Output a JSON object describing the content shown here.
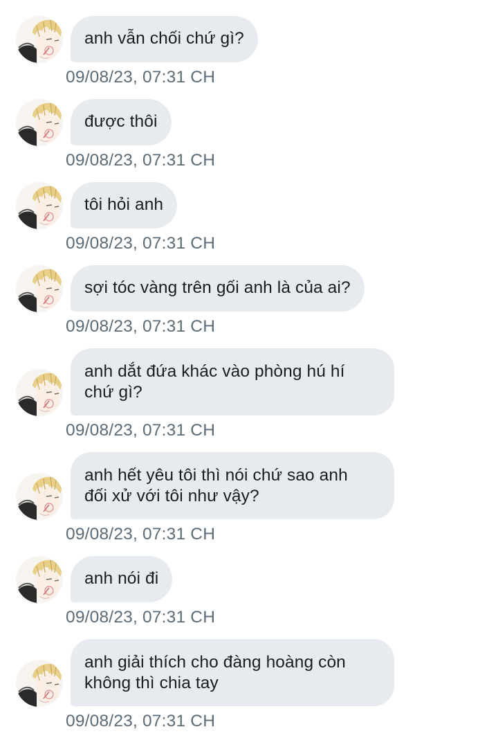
{
  "messages": [
    {
      "text": "anh vẫn chối chứ gì?",
      "time": "09/08/23, 07:31 CH"
    },
    {
      "text": "được thôi",
      "time": "09/08/23, 07:31 CH"
    },
    {
      "text": "tôi hỏi anh",
      "time": "09/08/23, 07:31 CH"
    },
    {
      "text": "sợi tóc vàng trên gối anh là của ai?",
      "time": "09/08/23, 07:31 CH"
    },
    {
      "text": "anh dắt đứa khác vào phòng hú hí\nchứ gì?",
      "time": "09/08/23, 07:31 CH"
    },
    {
      "text": "anh hết yêu tôi thì nói chứ sao anh\nđối xử với tôi như vậy?",
      "time": "09/08/23, 07:31 CH"
    },
    {
      "text": "anh nói đi",
      "time": "09/08/23, 07:31 CH"
    },
    {
      "text": "anh giải thích cho đàng hoàng còn\nkhông thì chia tay",
      "time": "09/08/23, 07:31 CH"
    }
  ],
  "avatar_icon": "profile-avatar-blond-anime-icon",
  "colors": {
    "bubble": "#e7ebef",
    "message_text": "#1a1d20",
    "timestamp": "#5b6b78",
    "background": "#ffffff"
  }
}
